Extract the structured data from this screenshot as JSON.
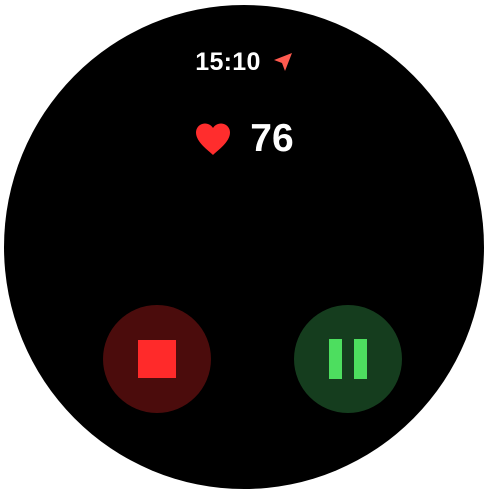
{
  "status": {
    "time": "15:10",
    "location_icon": "location-arrow-icon",
    "location_icon_color": "#ff5a4f"
  },
  "heart_rate": {
    "icon": "heart-icon",
    "icon_color": "#ff2d2d",
    "value": "76"
  },
  "controls": {
    "stop": {
      "icon": "stop-icon",
      "icon_color": "#ff2a2a",
      "background": "#4b0c0c"
    },
    "pause": {
      "icon": "pause-icon",
      "icon_color": "#4dde5f",
      "background": "#153d1e"
    }
  },
  "colors": {
    "face_background": "#000000",
    "text": "#ffffff"
  }
}
